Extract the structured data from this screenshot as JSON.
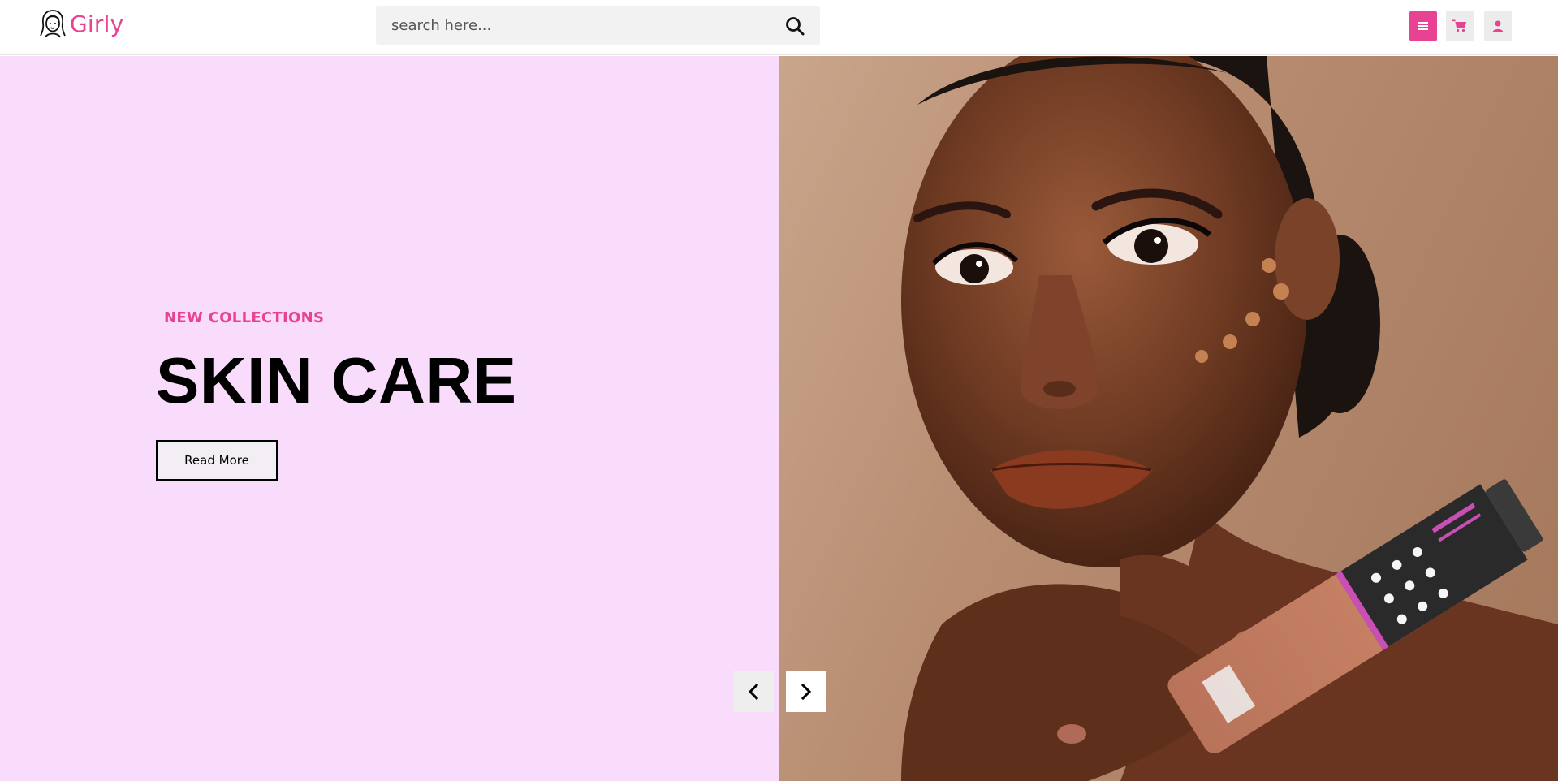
{
  "brand": {
    "name": "Girly",
    "accent_color": "#e84393",
    "logo_icon": "girl-face-icon"
  },
  "search": {
    "placeholder": "search here...",
    "icon": "search-icon"
  },
  "header_actions": [
    {
      "name": "menu",
      "icon": "hamburger-icon"
    },
    {
      "name": "cart",
      "icon": "shopping-cart-icon"
    },
    {
      "name": "account",
      "icon": "user-icon"
    }
  ],
  "hero": {
    "subtitle": "NEW COLLECTIONS",
    "title": "SKIN CARE",
    "button_label": "Read More",
    "background_color": "#f9dcfb",
    "image": "model-with-foundation-tube-photo",
    "prev_icon": "chevron-left-icon",
    "next_icon": "chevron-right-icon"
  }
}
